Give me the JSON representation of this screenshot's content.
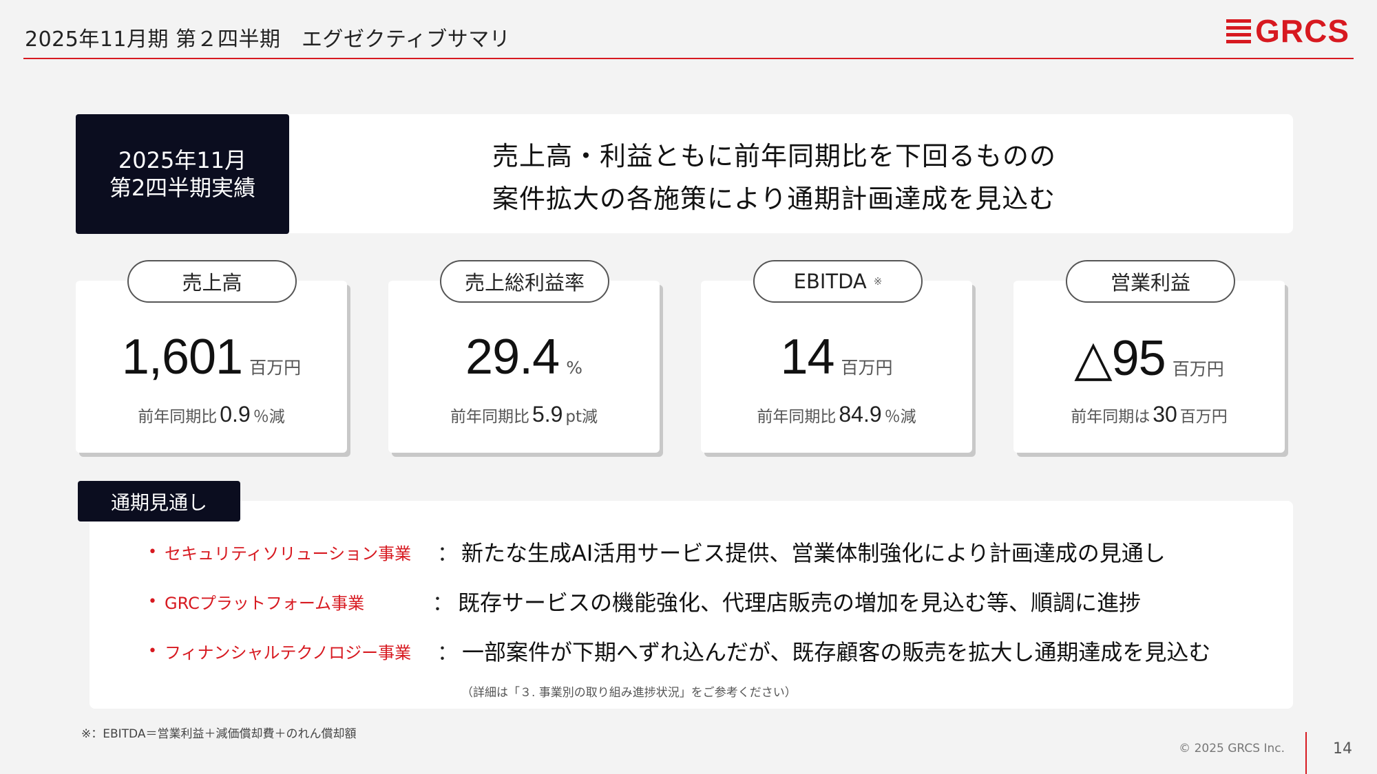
{
  "header": {
    "title": "2025年11月期 第２四半期　エグゼクティブサマリ",
    "logo_text": "GRCS"
  },
  "banner": {
    "label_line1": "2025年11月",
    "label_line2": "第2四半期実績",
    "headline_line1": "売上高・利益ともに前年同期比を下回るものの",
    "headline_line2": "案件拡大の各施策により通期計画達成を見込む"
  },
  "kpis": [
    {
      "label": "売上高",
      "value": "1,601",
      "unit": "百万円",
      "sub_prefix": "前年同期比",
      "sub_value": "0.9",
      "sub_suffix": "％減"
    },
    {
      "label": "売上総利益率",
      "value": "29.4",
      "unit": "%",
      "sub_prefix": "前年同期比",
      "sub_value": "5.9",
      "sub_suffix": "pt減"
    },
    {
      "label": "EBITDA",
      "label_mark": "※",
      "value": "14",
      "unit": "百万円",
      "sub_prefix": "前年同期比",
      "sub_value": "84.9",
      "sub_suffix": "％減"
    },
    {
      "label": "営業利益",
      "value": "△95",
      "unit": "百万円",
      "sub_prefix": "前年同期は",
      "sub_value": "30",
      "sub_suffix": "百万円"
    }
  ],
  "outlook": {
    "label": "通期見通し",
    "items": [
      {
        "bullet": "•",
        "segment": "セキュリティソリューション事業",
        "colon": "：",
        "description": "新たな生成AI活用サービス提供、営業体制強化により計画達成の見通し"
      },
      {
        "bullet": "•",
        "segment": "GRCプラットフォーム事業",
        "colon": "：",
        "description": "既存サービスの機能強化、代理店販売の増加を見込む等、順調に進捗"
      },
      {
        "bullet": "•",
        "segment": "フィナンシャルテクノロジー事業",
        "colon": "：",
        "description": "一部案件が下期へずれ込んだが、既存顧客の販売を拡大し通期達成を見込む"
      }
    ],
    "note": "（詳細は「３. 事業別の取り組み進捗状況」をご参考ください）"
  },
  "footer": {
    "footnote": "※：EBITDA＝営業利益＋減価償却費＋のれん償却額",
    "copyright": "© 2025 GRCS Inc.",
    "page_number": "14"
  },
  "colors": {
    "accent": "#d71920",
    "dark_label": "#0b0d1f",
    "background": "#f3f3f3"
  }
}
